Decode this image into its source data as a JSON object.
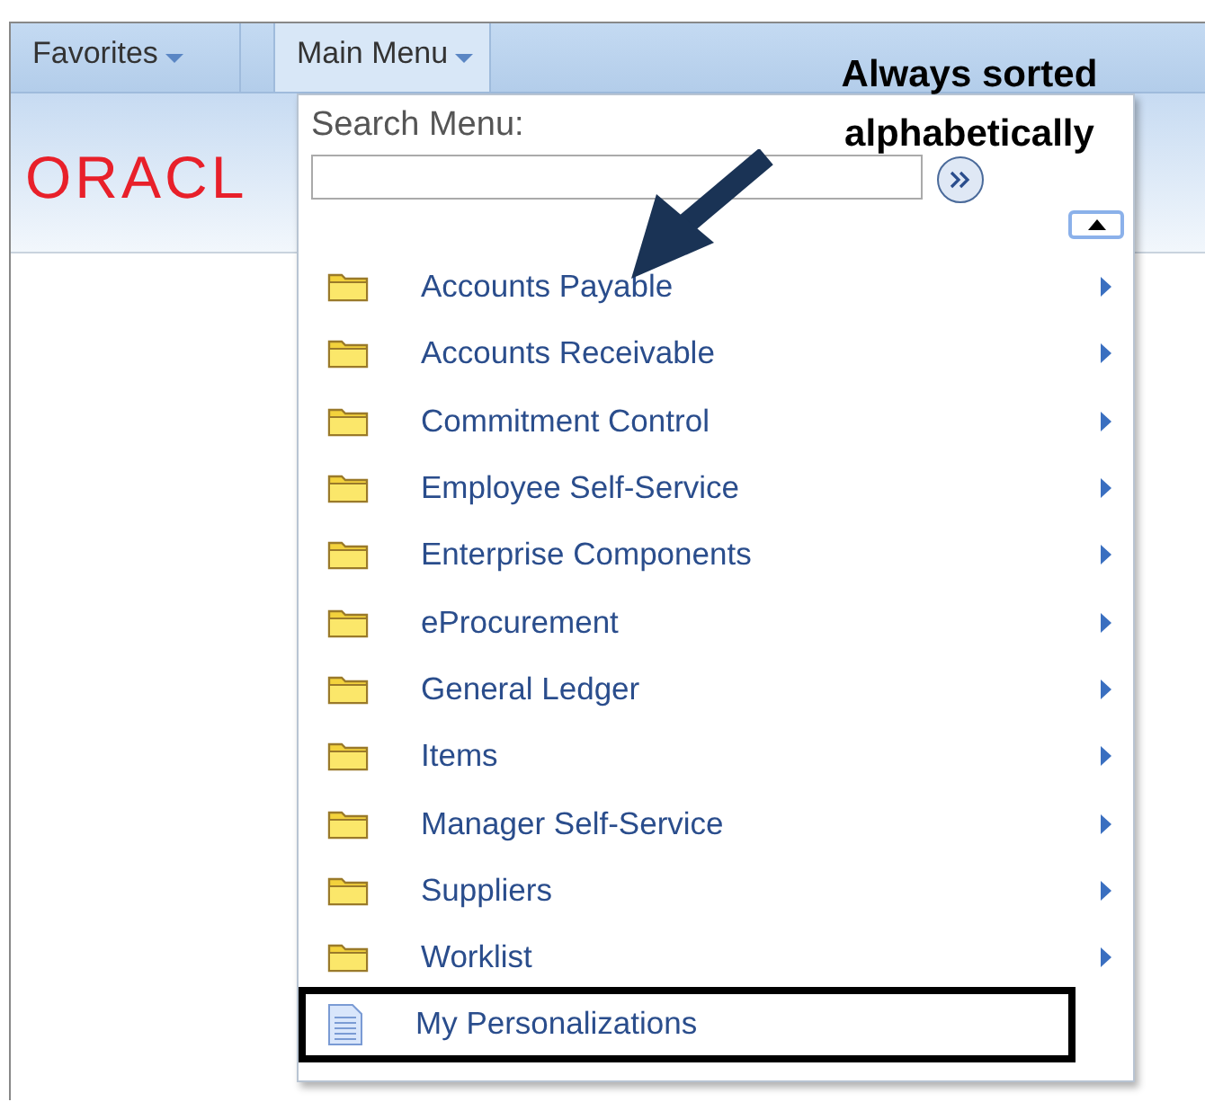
{
  "nav": [
    {
      "label": "Favorites",
      "selected": false
    },
    {
      "label": "Main Menu",
      "selected": true
    }
  ],
  "logo": "ORACL",
  "menu": {
    "search_label": "Search Menu:",
    "items": [
      {
        "label": "Accounts Payable",
        "kind": "folder",
        "highlighted": false
      },
      {
        "label": "Accounts Receivable",
        "kind": "folder",
        "highlighted": false
      },
      {
        "label": "Commitment Control",
        "kind": "folder",
        "highlighted": false
      },
      {
        "label": "Employee Self-Service",
        "kind": "folder",
        "highlighted": false
      },
      {
        "label": "Enterprise Components",
        "kind": "folder",
        "highlighted": false
      },
      {
        "label": "eProcurement",
        "kind": "folder",
        "highlighted": false
      },
      {
        "label": "General Ledger",
        "kind": "folder",
        "highlighted": false
      },
      {
        "label": "Items",
        "kind": "folder",
        "highlighted": false
      },
      {
        "label": "Manager Self-Service",
        "kind": "folder",
        "highlighted": false
      },
      {
        "label": "Suppliers",
        "kind": "folder",
        "highlighted": false
      },
      {
        "label": "Worklist",
        "kind": "folder",
        "highlighted": false
      },
      {
        "label": "My Personalizations",
        "kind": "document",
        "highlighted": true
      }
    ]
  },
  "annotation": "Always sorted alphabetically"
}
